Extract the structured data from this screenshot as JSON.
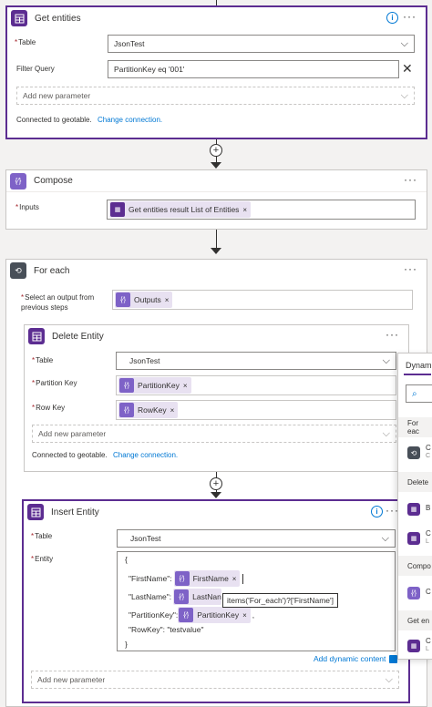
{
  "get_entities": {
    "title": "Get entities",
    "table_label": "Table",
    "table_value": "JsonTest",
    "filter_label": "Filter Query",
    "filter_value": "PartitionKey eq '001'",
    "add_param": "Add new parameter",
    "connected": "Connected to geotable.",
    "change_conn": "Change connection."
  },
  "compose": {
    "title": "Compose",
    "inputs_label": "Inputs",
    "token": "Get entities result List of Entities"
  },
  "for_each": {
    "title": "For each",
    "select_label_1": "Select an output from",
    "select_label_2": "previous steps",
    "token": "Outputs"
  },
  "delete_entity": {
    "title": "Delete Entity",
    "table_label": "Table",
    "table_value": "JsonTest",
    "pk_label": "Partition Key",
    "pk_token": "PartitionKey",
    "rk_label": "Row Key",
    "rk_token": "RowKey",
    "add_param": "Add new parameter",
    "connected": "Connected to geotable.",
    "change_conn": "Change connection."
  },
  "insert_entity": {
    "title": "Insert Entity",
    "table_label": "Table",
    "table_value": "JsonTest",
    "entity_label": "Entity",
    "json_open": "{",
    "line1_key": "\"FirstName\":",
    "line1_token": "FirstName",
    "line2_key": "\"LastName\":",
    "line2_token": "LastNan",
    "line3_key": "\"PartitionKey\":",
    "line3_token": "PartitionKey",
    "line3_suffix": ",",
    "line4": "\"RowKey\": \"testvalue\"",
    "json_close": "}",
    "tooltip": "items('For_each')?['FirstName']",
    "add_dynamic": "Add dynamic content",
    "add_param": "Add new parameter"
  },
  "dynamic_panel": {
    "title": "Dynam",
    "sec_foreach": "For eac",
    "sec_delete": "Delete",
    "sec_compose": "Compo",
    "sec_get": "Get en",
    "item_c": "C",
    "item_b": "B",
    "item_sub_c": "C",
    "item_sub_l": "L"
  },
  "colors": {
    "purple_dark": "#5c2d91",
    "purple_token": "#7e62c7",
    "token_bg": "#e8e1f1",
    "foreach_blue": "#484f58",
    "link": "#0078d4",
    "info_blue": "#0078d4"
  },
  "icons": {
    "table_storage": "table-storage-icon",
    "compose": "compose-icon",
    "foreach": "loop-icon",
    "info": "info-icon",
    "more": "more-options-icon"
  }
}
